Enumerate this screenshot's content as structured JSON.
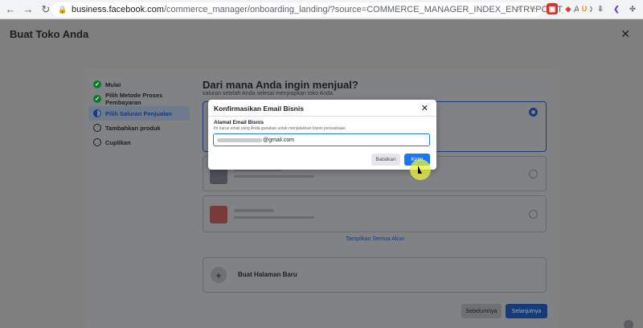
{
  "browser": {
    "url_host": "business.facebook.com",
    "url_path": "/commerce_manager/onboarding_landing/?source=COMMERCE_MANAGER_INDEX_ENTRYPOINT_CARD",
    "ext_u": "U"
  },
  "app": {
    "title": "Buat Toko Anda",
    "close_glyph": "✕"
  },
  "steps": [
    {
      "label": "Mulai",
      "state": "done"
    },
    {
      "label": "Pilih Metode Proses Pembayaran",
      "state": "done"
    },
    {
      "label": "Pilih Saluran Penjualan",
      "state": "current"
    },
    {
      "label": "Tambahkan produk",
      "state": "todo"
    },
    {
      "label": "Cuplikan",
      "state": "todo"
    }
  ],
  "main": {
    "title": "Dari mana Anda ingin menjual?",
    "subtitle": "saluran setelah Anda selesai menyiapkan toko Anda.",
    "show_all": "Tampilkan Semua Akun",
    "new_page": "Buat Halaman Baru",
    "plus": "+",
    "prev_button": "Sebelumnya",
    "next_button": "Selanjutnya"
  },
  "dialog": {
    "title": "Konfirmasikan Email Bisnis",
    "close_glyph": "✕",
    "field_label": "Alamat Email Bisnis",
    "help_text": "Ini harus email yang Anda gunakan untuk menjalankan bisnis perusahaan.",
    "email_suffix": "@gmail.com",
    "cancel_button": "Batalkan",
    "send_button": "Kirim"
  },
  "colors": {
    "primary": "#1877f2",
    "overlay": "#7f7f80",
    "done_step": "#0d7a2b"
  }
}
